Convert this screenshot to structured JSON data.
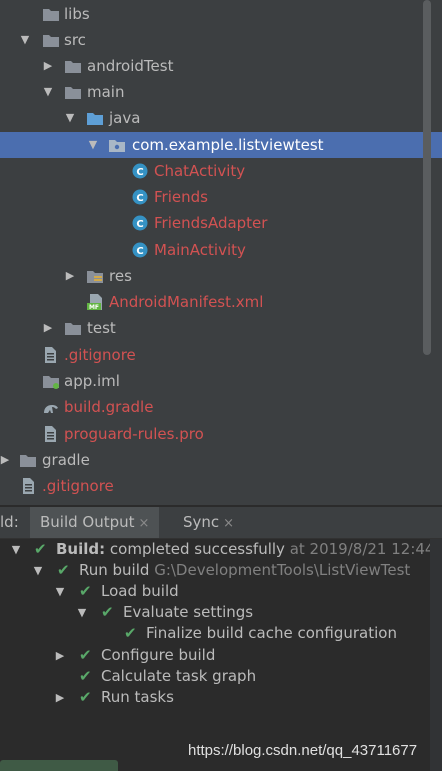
{
  "tree": {
    "items": [
      {
        "label": "libs"
      },
      {
        "label": "src"
      },
      {
        "label": "androidTest"
      },
      {
        "label": "main"
      },
      {
        "label": "java"
      },
      {
        "label": "com.example.listviewtest"
      },
      {
        "label": "ChatActivity"
      },
      {
        "label": "Friends"
      },
      {
        "label": "FriendsAdapter"
      },
      {
        "label": "MainActivity"
      },
      {
        "label": "res"
      },
      {
        "label": "AndroidManifest.xml"
      },
      {
        "label": "test"
      },
      {
        "label": ".gitignore"
      },
      {
        "label": "app.iml"
      },
      {
        "label": "build.gradle"
      },
      {
        "label": "proguard-rules.pro"
      },
      {
        "label": "gradle"
      },
      {
        "label": ".gitignore"
      }
    ]
  },
  "build_panel": {
    "prefix": "ld:",
    "tabs": [
      {
        "label": "Build Output"
      },
      {
        "label": "Sync"
      }
    ],
    "close_glyph": "×",
    "rows": [
      {
        "bold": "Build:",
        "text": " completed successfully",
        "meta": " at 2019/8/21 12:44"
      },
      {
        "text": "Run build",
        "meta": " G:\\DevelopmentTools\\ListViewTest"
      },
      {
        "text": "Load build"
      },
      {
        "text": "Evaluate settings"
      },
      {
        "text": "Finalize build cache configuration"
      },
      {
        "text": "Configure build"
      },
      {
        "text": "Calculate task graph"
      },
      {
        "text": "Run tasks"
      }
    ]
  },
  "watermark": "https://blog.csdn.net/qq_43711677",
  "colors": {
    "selection": "#4b6eaf",
    "error_text": "#d25252",
    "success": "#59a869",
    "folder": "#8a9099",
    "source_folder": "#5e9fd6",
    "class_icon": "#3592c4"
  }
}
